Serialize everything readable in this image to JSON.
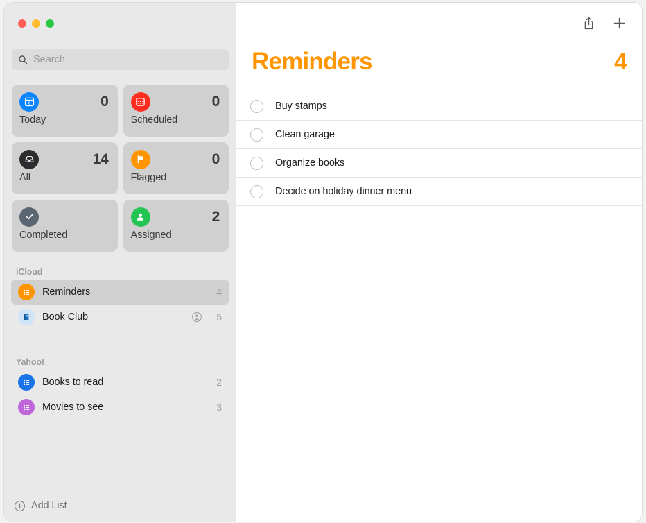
{
  "window": {
    "traffic_lights": [
      {
        "name": "close",
        "color": "#ff5f57"
      },
      {
        "name": "minimize",
        "color": "#febc2e"
      },
      {
        "name": "maximize",
        "color": "#28c840"
      }
    ]
  },
  "sidebar": {
    "search": {
      "placeholder": "Search",
      "value": "",
      "icon": "search-icon"
    },
    "smart_lists": [
      {
        "label": "Today",
        "count": "0",
        "icon": "calendar-day-icon",
        "color": "#0a84ff"
      },
      {
        "label": "Scheduled",
        "count": "0",
        "icon": "calendar-grid-icon",
        "color": "#ff2d20"
      },
      {
        "label": "All",
        "count": "14",
        "icon": "inbox-tray-icon",
        "color": "#2d2d30"
      },
      {
        "label": "Flagged",
        "count": "0",
        "icon": "flag-icon",
        "color": "#ff9500"
      },
      {
        "label": "Completed",
        "count": "",
        "icon": "checkmark-icon",
        "color": "#5b6673"
      },
      {
        "label": "Assigned",
        "count": "2",
        "icon": "person-icon",
        "color": "#23c552"
      }
    ],
    "groups": [
      {
        "title": "iCloud",
        "lists": [
          {
            "name": "Reminders",
            "count": "4",
            "icon": "list-bullets-icon",
            "color": "#ff9500",
            "selected": true,
            "shared": false
          },
          {
            "name": "Book Club",
            "count": "5",
            "icon": "book-icon",
            "color": "#cfe4f7",
            "selected": false,
            "shared": true
          }
        ]
      },
      {
        "title": "Yahoo!",
        "lists": [
          {
            "name": "Books to read",
            "count": "2",
            "icon": "list-bullets-icon",
            "color": "#1a74e8",
            "selected": false,
            "shared": false
          },
          {
            "name": "Movies to see",
            "count": "3",
            "icon": "list-bullets-icon",
            "color": "#bf67d8",
            "selected": false,
            "shared": false
          }
        ]
      }
    ],
    "add_list": {
      "label": "Add List",
      "icon": "plus-circle-icon"
    }
  },
  "main": {
    "toolbar": [
      {
        "name": "share-button",
        "icon": "share-icon"
      },
      {
        "name": "add-reminder-button",
        "icon": "plus-icon"
      }
    ],
    "title": "Reminders",
    "count": "4",
    "accent_color": "#ff9500",
    "reminders": [
      {
        "title": "Buy stamps",
        "completed": false
      },
      {
        "title": "Clean garage",
        "completed": false
      },
      {
        "title": "Organize books",
        "completed": false
      },
      {
        "title": "Decide on holiday dinner menu",
        "completed": false
      }
    ]
  }
}
